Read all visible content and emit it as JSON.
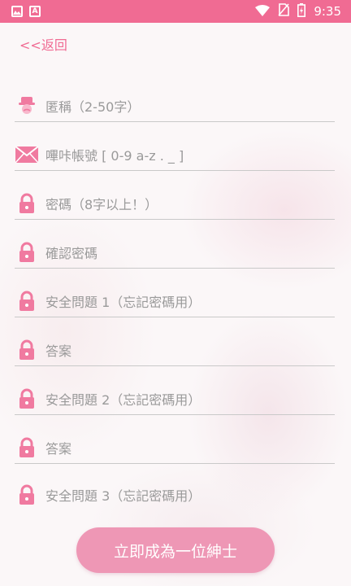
{
  "status_bar": {
    "time": "9:35",
    "left_icons": [
      "image-icon",
      "a-icon"
    ],
    "right_icons": [
      "wifi-icon",
      "no-sim-icon",
      "battery-icon"
    ]
  },
  "nav": {
    "back_label": "<<返回"
  },
  "form": {
    "fields": [
      {
        "icon": "user-icon",
        "placeholder": "匿稱（2-50字）"
      },
      {
        "icon": "mail-icon",
        "placeholder": "嗶咔帳號 [ 0-9 a-z . _ ]"
      },
      {
        "icon": "lock-icon",
        "placeholder": "密碼（8字以上！）"
      },
      {
        "icon": "lock-icon",
        "placeholder": "確認密碼"
      },
      {
        "icon": "lock-icon",
        "placeholder": "安全問題 1（忘記密碼用）"
      },
      {
        "icon": "lock-icon",
        "placeholder": "答案"
      },
      {
        "icon": "lock-icon",
        "placeholder": "安全問題 2（忘記密碼用）"
      },
      {
        "icon": "lock-icon",
        "placeholder": "答案"
      },
      {
        "icon": "lock-icon",
        "placeholder": "安全問題 3（忘記密碼用）"
      }
    ],
    "submit_label": "立即成為一位紳士"
  },
  "colors": {
    "accent": "#f06b93",
    "button": "#ee97b5",
    "icon": "#f07aa0",
    "placeholder": "#9a9a9a",
    "underline": "#c9c9c9"
  }
}
